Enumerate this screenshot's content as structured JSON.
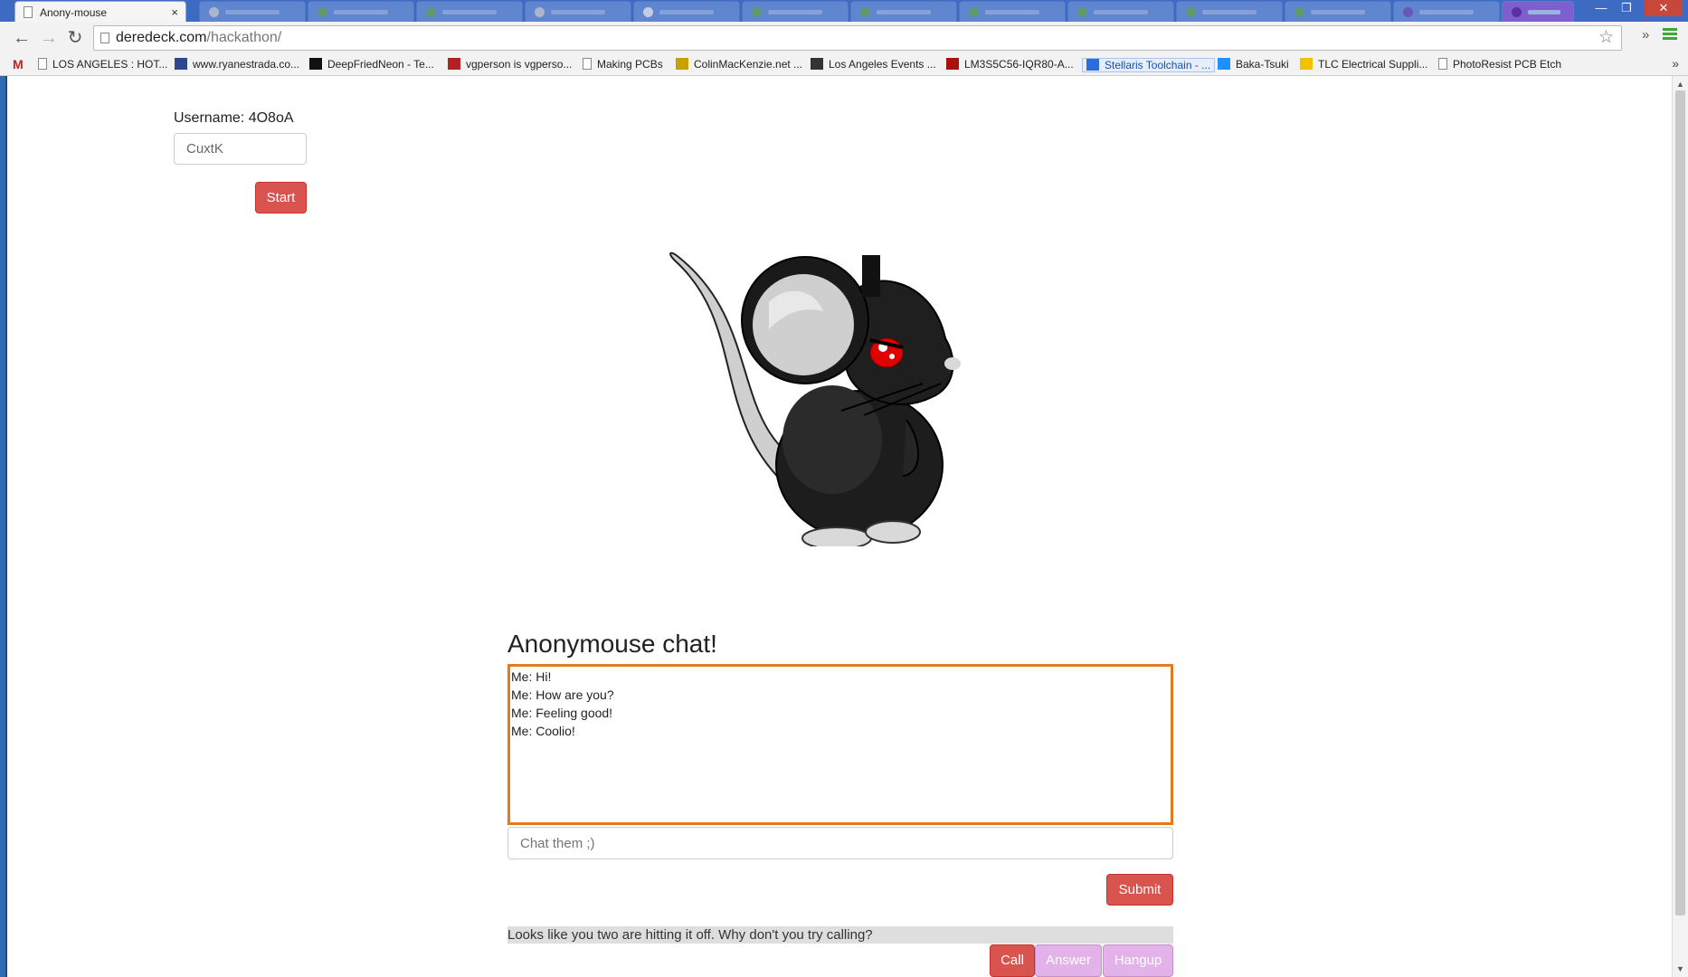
{
  "browser": {
    "active_tab_title": "Anony-mouse",
    "tab_close": "×",
    "url_host": "deredeck.com",
    "url_path": "/hackathon/",
    "back": "←",
    "forward": "→",
    "reload": "↻",
    "star": "☆",
    "extensions_more": "»",
    "window_minimize": "—",
    "window_restore": "❐",
    "window_close": "✕"
  },
  "bookmarks": {
    "items": [
      {
        "label": "LOS ANGELES : HOT...",
        "icon": "page-icon",
        "color": "#e0e0e0"
      },
      {
        "label": "www.ryanestrada.co...",
        "icon": "site-icon",
        "color": "#2b4a8a"
      },
      {
        "label": "DeepFriedNeon - Te...",
        "icon": "site-icon",
        "color": "#111111"
      },
      {
        "label": "vgperson is vgperso...",
        "icon": "site-icon",
        "color": "#b22222"
      },
      {
        "label": "Making PCBs",
        "icon": "page-icon",
        "color": "#e0e0e0"
      },
      {
        "label": "ColinMacKenzie.net ...",
        "icon": "site-icon",
        "color": "#c8a000"
      },
      {
        "label": "Los Angeles Events ...",
        "icon": "site-icon",
        "color": "#333333"
      },
      {
        "label": "LM3S5C56-IQR80-A...",
        "icon": "site-icon",
        "color": "#aa1111"
      },
      {
        "label": "Stellaris Toolchain - ...",
        "icon": "site-icon",
        "color": "#2a6fd6"
      },
      {
        "label": "Baka-Tsuki",
        "icon": "site-icon",
        "color": "#1e90ff"
      },
      {
        "label": "TLC Electrical Suppli...",
        "icon": "site-icon",
        "color": "#f2c200"
      },
      {
        "label": "PhotoResist PCB Etch",
        "icon": "page-icon",
        "color": "#e0e0e0"
      }
    ],
    "more": "»"
  },
  "page": {
    "username_label": "Username: 4O8oA",
    "name_input_value": "CuxtK",
    "start_button": "Start",
    "chat_title": "Anonymouse chat!",
    "chat_messages": [
      "Me: Hi!",
      "Me: How are you?",
      "Me: Feeling good!",
      "Me: Coolio!"
    ],
    "chat_input_placeholder": "Chat them ;)",
    "submit_button": "Submit",
    "call_prompt": "Looks like you two are hitting it off. Why don't you try calling?",
    "call_button": "Call",
    "answer_button": "Answer",
    "hangup_button": "Hangup"
  },
  "colors": {
    "tabstrip": "#3d6bc3",
    "button_red": "#d9534f",
    "button_disabled": "#e3b2e8",
    "chat_focus_border": "#e07b20",
    "mouse_eye": "#e00000"
  }
}
